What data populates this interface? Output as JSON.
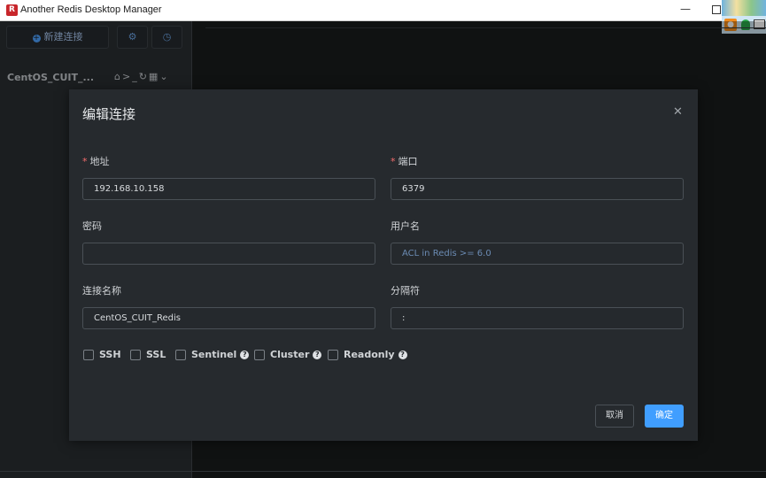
{
  "window": {
    "title": "Another Redis Desktop Manager"
  },
  "sidebar": {
    "new_connection_label": "新建连接",
    "connection_name": "CentOS_CUIT_...",
    "icons": [
      "home-icon",
      "terminal-icon",
      "refresh-icon",
      "grid-icon",
      "chevron-down-icon"
    ]
  },
  "dialog": {
    "title": "编辑连接",
    "fields": {
      "host": {
        "label": "地址",
        "value": "192.168.10.158",
        "required": true
      },
      "port": {
        "label": "端口",
        "value": "6379",
        "required": true
      },
      "password": {
        "label": "密码",
        "value": ""
      },
      "username": {
        "label": "用户名",
        "value": "",
        "placeholder": "ACL in Redis >= 6.0"
      },
      "name": {
        "label": "连接名称",
        "value": "CentOS_CUIT_Redis"
      },
      "separator": {
        "label": "分隔符",
        "value": ":"
      }
    },
    "options": {
      "ssh": {
        "label": "SSH",
        "checked": false
      },
      "ssl": {
        "label": "SSL",
        "checked": false
      },
      "sentinel": {
        "label": "Sentinel",
        "checked": false
      },
      "cluster": {
        "label": "Cluster",
        "checked": false
      },
      "readonly": {
        "label": "Readonly",
        "checked": false
      }
    },
    "cancel_label": "取消",
    "ok_label": "确定"
  },
  "colors": {
    "accent": "#409eff",
    "required": "#f56c6c",
    "background": "#262a2e"
  }
}
